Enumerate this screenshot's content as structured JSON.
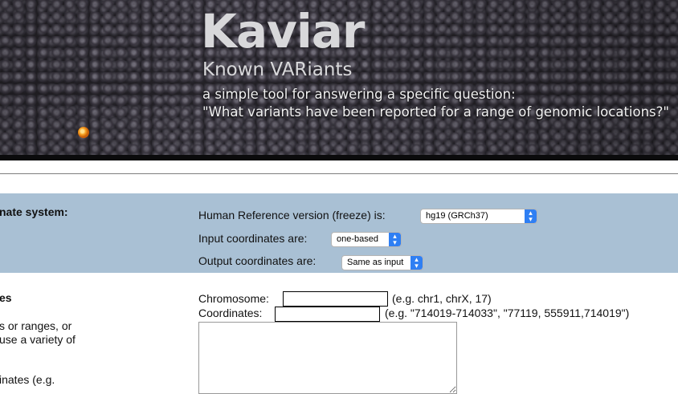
{
  "banner": {
    "title": "Kaviar",
    "subtitle": "Known VARiants",
    "tagline_1": "a simple tool for answering a specific question:",
    "tagline_2": "\"What variants have been reported for a range of genomic locations?\""
  },
  "coordinate_section": {
    "heading": "nate system:",
    "reference_label": "Human Reference version (freeze) is:",
    "reference_value": "hg19 (GRCh37)",
    "input_label": "Input coordinates are:",
    "input_value": "one-based",
    "output_label": "Output coordinates are:",
    "output_value": "Same as input"
  },
  "query_section": {
    "heading": "es",
    "desc_line_1": "s or ranges, or",
    "desc_line_2": "use a variety of",
    "desc_line_3": "inates (e.g.",
    "chromosome_label": "Chromosome:",
    "chromosome_value": "",
    "chromosome_example": "(e.g. chr1, chrX, 17)",
    "coordinates_label": "Coordinates:",
    "coordinates_value": "",
    "coordinates_example": "(e.g. \"714019-714033\", \"77119, 555911,714019\")",
    "bulk_value": ""
  },
  "colors": {
    "panel_blue": "#a9c0d4",
    "select_arrow_blue": "#2f7ff3",
    "banner_dark": "#232126"
  },
  "icons": {
    "banner_dot": "orange-egg-icon",
    "select_arrows": "up-down-chevron-icon"
  }
}
